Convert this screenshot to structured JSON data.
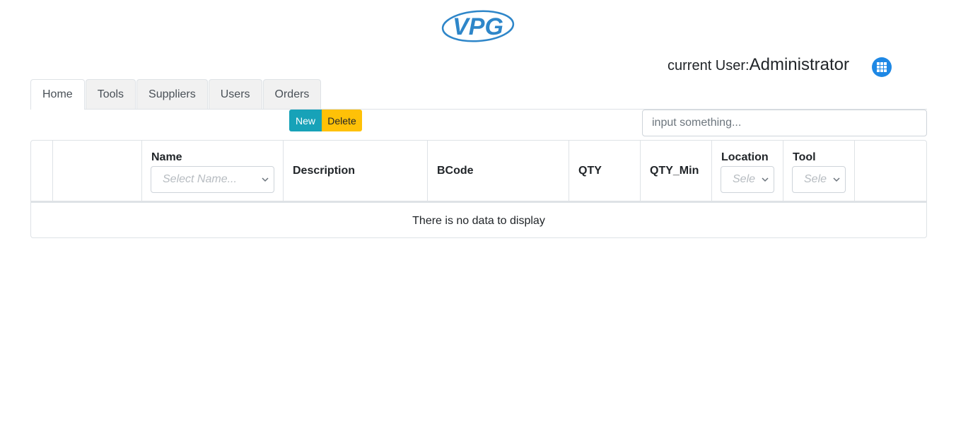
{
  "header": {
    "logo_text": "VPG",
    "user_prefix": "current User:",
    "user_name": "Administrator",
    "apps_icon": "grid-apps-icon",
    "colors": {
      "logo_blue": "#2e86c9",
      "apps_blue": "#1e88e5"
    }
  },
  "tabs": [
    {
      "label": "Home",
      "active": true
    },
    {
      "label": "Tools",
      "active": false
    },
    {
      "label": "Suppliers",
      "active": false
    },
    {
      "label": "Users",
      "active": false
    },
    {
      "label": "Orders",
      "active": false
    }
  ],
  "toolbar": {
    "new_label": "New",
    "delete_label": "Delete",
    "search_placeholder": "input something...",
    "colors": {
      "new": "#17a2b8",
      "delete": "#ffc107"
    }
  },
  "table": {
    "columns": {
      "name": {
        "label": "Name",
        "filter_placeholder": "Select Name..."
      },
      "description": {
        "label": "Description"
      },
      "bcode": {
        "label": "BCode"
      },
      "qty": {
        "label": "QTY"
      },
      "qty_min": {
        "label": "QTY_Min"
      },
      "location": {
        "label": "Location",
        "filter_placeholder": "Sele"
      },
      "tool": {
        "label": "Tool",
        "filter_placeholder": "Sele"
      }
    },
    "empty_message": "There is no data to display"
  }
}
